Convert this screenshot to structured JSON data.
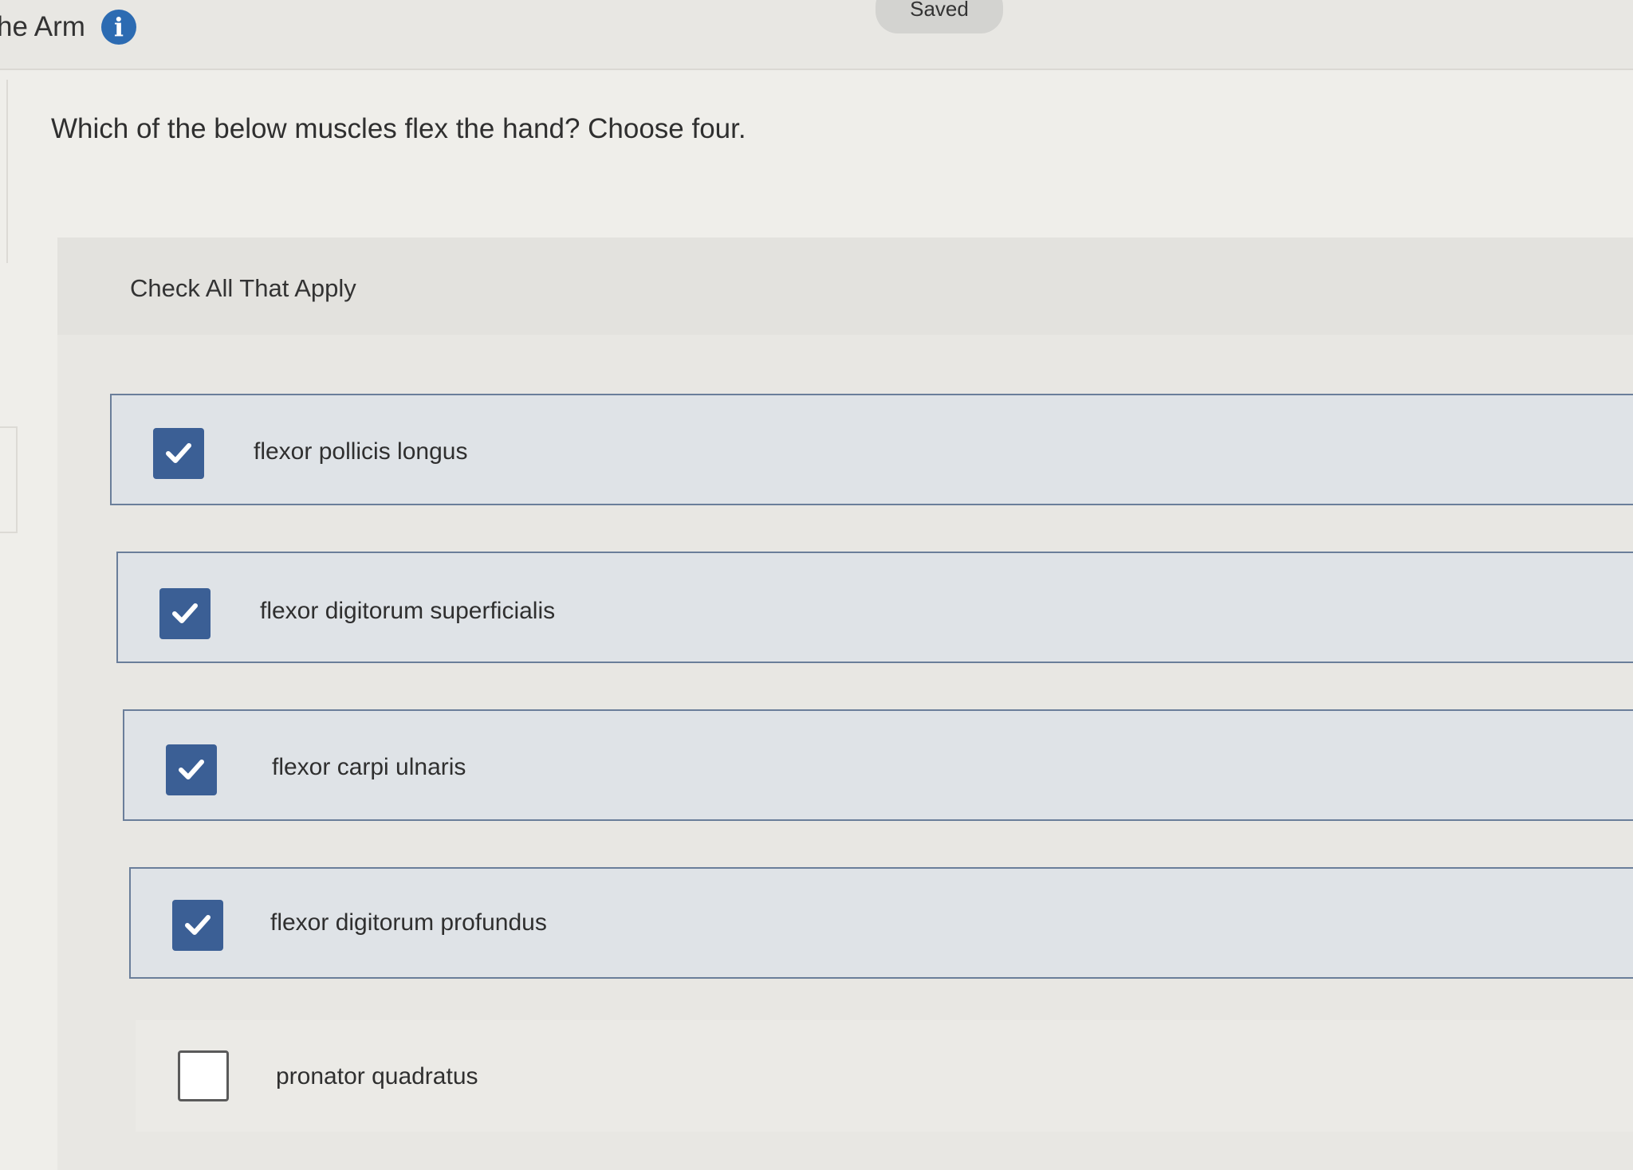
{
  "header": {
    "title": "he Arm",
    "info_icon": "info-icon",
    "saved_label": "Saved"
  },
  "question": {
    "text": "Which of the below muscles flex the hand? Choose four."
  },
  "answers": {
    "instruction": "Check All That Apply",
    "options": [
      {
        "label": "flexor pollicis longus",
        "checked": true
      },
      {
        "label": "flexor digitorum superficialis",
        "checked": true
      },
      {
        "label": "flexor carpi ulnaris",
        "checked": true
      },
      {
        "label": "flexor digitorum profundus",
        "checked": true
      },
      {
        "label": "pronator quadratus",
        "checked": false
      }
    ]
  },
  "colors": {
    "accent": "#2c6bb2",
    "checkbox_checked": "#3b5f95",
    "selected_border": "#6a7e9a",
    "selected_bg": "#dfe3e7"
  }
}
